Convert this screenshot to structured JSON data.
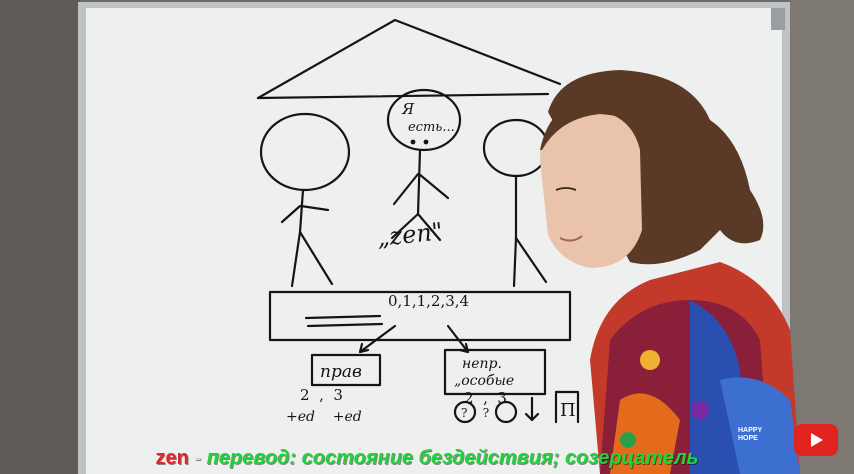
{
  "board_text": {
    "speech": "Я есть...",
    "speech_line1": "Я",
    "speech_line2": "есть...",
    "zen_label": "„zen\"",
    "numbers": "0,1,1,2,3,4",
    "left_box": "прав",
    "right_box_line1": "непр.",
    "right_box_line2": "„особые",
    "left_counts": "2  ,  3",
    "left_suffix": "+ed    +ed",
    "right_counts": "2  ,  3",
    "right_marks": "?    ?",
    "edge_box": "П"
  },
  "caption": {
    "word": "zen",
    "separator": " - ",
    "translation": "перевод: состояние бездействия; созерцатель"
  },
  "overlay": {
    "brand_line1": "HAPPY",
    "brand_line2": "HOPE",
    "play_icon": "youtube-play-icon"
  },
  "colors": {
    "board": "#eef0ef",
    "marker": "#151515",
    "hair": "#5a3a26",
    "skin": "#e9c3ab",
    "caption_word": "#e0252f",
    "caption_translation": "#22d23a",
    "youtube_red": "#e02420"
  }
}
